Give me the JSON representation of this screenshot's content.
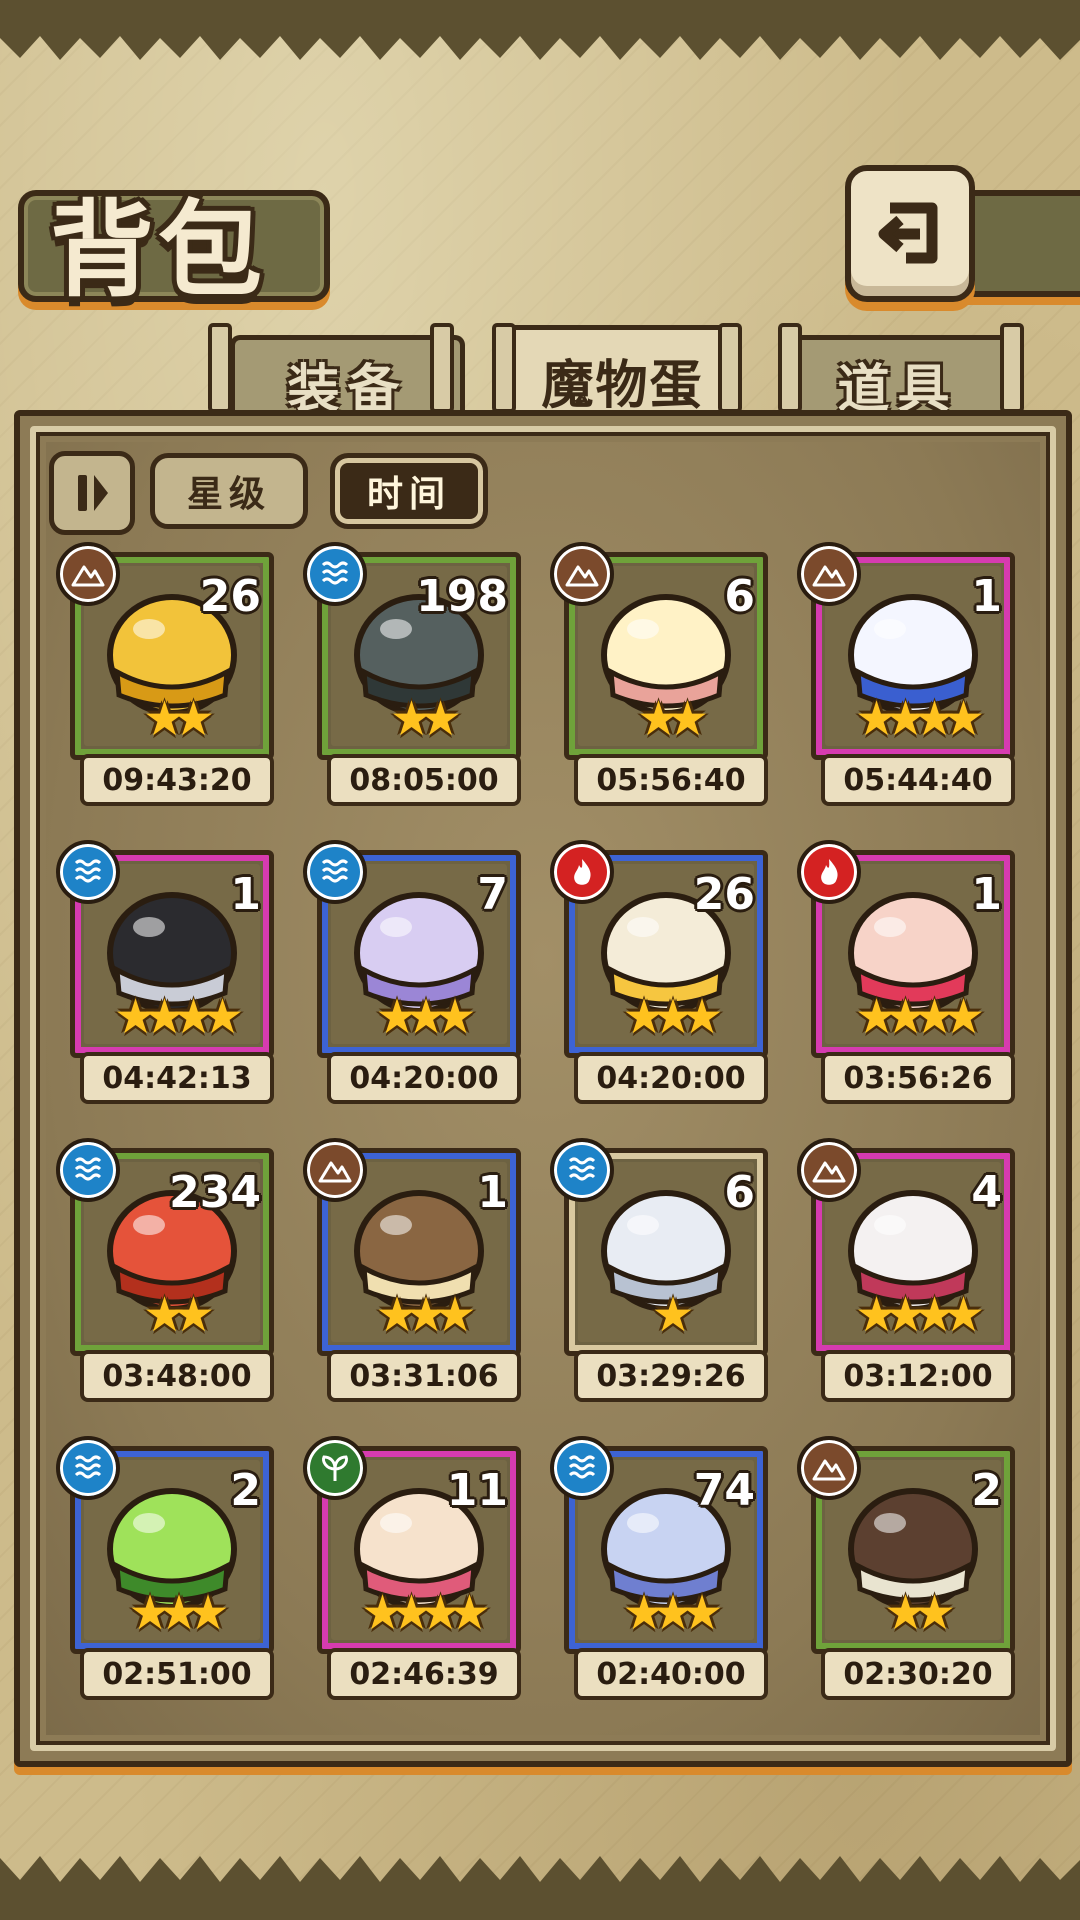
{
  "header": {
    "title": "背包"
  },
  "tabs": [
    {
      "label": "装备",
      "active": false
    },
    {
      "label": "魔物蛋",
      "active": true
    },
    {
      "label": "道具",
      "active": false
    }
  ],
  "sort": {
    "order_icon": "sort-order-icon",
    "options": [
      "星级",
      "时间"
    ],
    "selected": "时间"
  },
  "colors": {
    "frame_green": "#6fa23a",
    "frame_blue": "#3d63d4",
    "frame_pink": "#d63bb0",
    "frame_tan": "#d9c9a0",
    "water": "#1e83c8",
    "earth": "#7b4a2c",
    "fire": "#d42222",
    "wood": "#2f7a2f"
  },
  "eggs": [
    {
      "count": "26",
      "element": "earth",
      "frame": "green",
      "stars": "★★",
      "time": "09:43:20",
      "art": "golden-slime-egg"
    },
    {
      "count": "198",
      "element": "water",
      "frame": "green",
      "stars": "★★",
      "time": "08:05:00",
      "art": "turtle-shell-egg"
    },
    {
      "count": "6",
      "element": "earth",
      "frame": "green",
      "stars": "★★",
      "time": "05:56:40",
      "art": "cream-egg-in-cup"
    },
    {
      "count": "1",
      "element": "earth",
      "frame": "pink",
      "stars": "★★★★",
      "time": "05:44:40",
      "art": "white-blue-orb-egg"
    },
    {
      "count": "1",
      "element": "water",
      "frame": "pink",
      "stars": "★★★★",
      "time": "04:42:13",
      "art": "black-spike-egg"
    },
    {
      "count": "7",
      "element": "water",
      "frame": "blue",
      "stars": "★★★",
      "time": "04:20:00",
      "art": "purple-jelly-egg"
    },
    {
      "count": "26",
      "element": "fire",
      "frame": "blue",
      "stars": "★★★",
      "time": "04:20:00",
      "art": "sun-egg"
    },
    {
      "count": "1",
      "element": "fire",
      "frame": "pink",
      "stars": "★★★★",
      "time": "03:56:26",
      "art": "kimono-egg"
    },
    {
      "count": "234",
      "element": "water",
      "frame": "green",
      "stars": "★★",
      "time": "03:48:00",
      "art": "crab-egg"
    },
    {
      "count": "1",
      "element": "earth",
      "frame": "blue",
      "stars": "★★★",
      "time": "03:31:06",
      "art": "monkey-basket-egg"
    },
    {
      "count": "6",
      "element": "water",
      "frame": "tan",
      "stars": "★",
      "time": "03:29:26",
      "art": "swirl-cloud-egg"
    },
    {
      "count": "4",
      "element": "earth",
      "frame": "pink",
      "stars": "★★★★",
      "time": "03:12:00",
      "art": "cracked-white-egg"
    },
    {
      "count": "2",
      "element": "water",
      "frame": "blue",
      "stars": "★★★",
      "time": "02:51:00",
      "art": "green-jelly-egg"
    },
    {
      "count": "11",
      "element": "wood",
      "frame": "pink",
      "stars": "★★★★",
      "time": "02:46:39",
      "art": "feather-nest-egg"
    },
    {
      "count": "74",
      "element": "water",
      "frame": "blue",
      "stars": "★★★",
      "time": "02:40:00",
      "art": "crystal-egg"
    },
    {
      "count": "2",
      "element": "earth",
      "frame": "green",
      "stars": "★★",
      "time": "02:30:20",
      "art": "bean-pod-egg"
    }
  ]
}
